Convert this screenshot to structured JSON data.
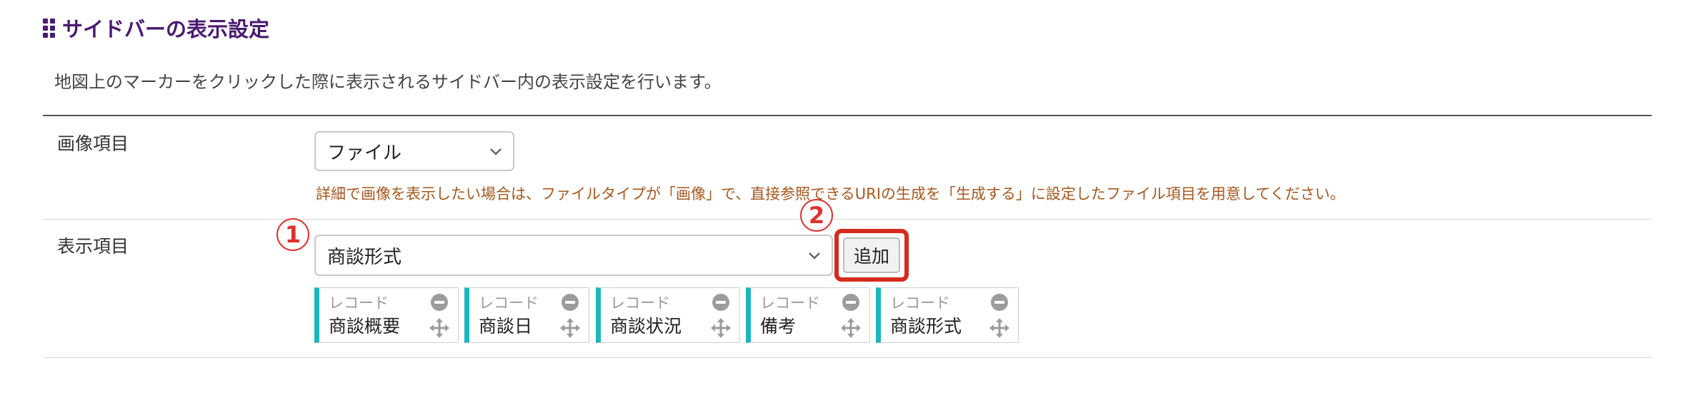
{
  "section": {
    "title": "サイドバーの表示設定",
    "description": "地図上のマーカーをクリックした際に表示されるサイドバー内の表示設定を行います。"
  },
  "image_field": {
    "label": "画像項目",
    "selected": "ファイル",
    "hint": "詳細で画像を表示したい場合は、ファイルタイプが「画像」で、直接参照できるURIの生成を「生成する」に設定したファイル項目を用意してください。"
  },
  "display_field": {
    "label": "表示項目",
    "selected": "商談形式",
    "add_label": "追加",
    "chips": [
      {
        "type": "レコード",
        "name": "商談概要"
      },
      {
        "type": "レコード",
        "name": "商談日"
      },
      {
        "type": "レコード",
        "name": "商談状況"
      },
      {
        "type": "レコード",
        "name": "備考"
      },
      {
        "type": "レコード",
        "name": "商談形式"
      }
    ]
  },
  "annotations": {
    "step1": "1",
    "step2": "2",
    "accent_color": "#e0322c"
  },
  "colors": {
    "title": "#4b1a72",
    "hint": "#a8571d",
    "chip_accent": "#1bb7be"
  },
  "icons": {
    "grip": "drag-grip-icon",
    "chevron": "chevron-down-icon",
    "remove": "minus-circle-icon",
    "move": "move-arrows-icon"
  }
}
